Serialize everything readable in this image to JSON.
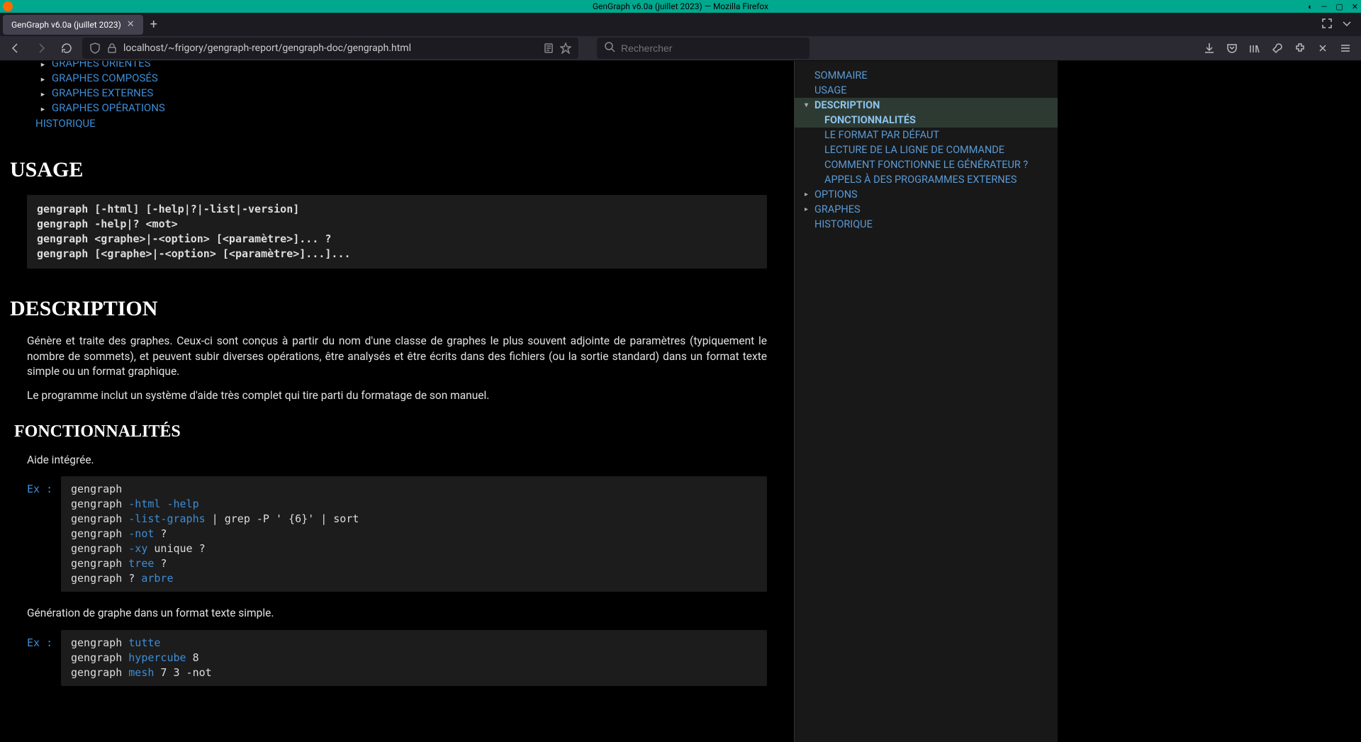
{
  "window": {
    "title": "GenGraph v6.0a (juillet 2023) — Mozilla Firefox"
  },
  "tab": {
    "title": "GenGraph v6.0a (juillet 2023)"
  },
  "urlbar": {
    "url": "localhost/~frigory/gengraph-report/gengraph-doc/gengraph.html"
  },
  "searchbar": {
    "placeholder": "Rechercher"
  },
  "toc_bullets": [
    "GRAPHES ORIENTÉS",
    "GRAPHES COMPOSÉS",
    "GRAPHES EXTERNES",
    "GRAPHES OPÉRATIONS"
  ],
  "toc_historique": "HISTORIQUE",
  "sections": {
    "usage_title": "USAGE",
    "usage_code": "gengraph [-html] [-help|?|-list|-version]\ngengraph -help|? <mot>\ngengraph <graphe>|-<option> [<paramètre>]... ?\ngengraph [<graphe>|-<option> [<paramètre>]...]...",
    "desc_title": "DESCRIPTION",
    "desc_p1": "Génère et traite des graphes. Ceux-ci sont conçus à partir du nom d'une classe de graphes le plus souvent adjointe de paramètres (typiquement le nombre de sommets), et peuvent su­bir diverses opérations, être analysés et être écrits dans des fichiers (ou la sortie standard) dans un format texte simple ou un format graphique.",
    "desc_p2": "Le programme inclut un système d'aide très complet qui tire parti du formatage de son manuel.",
    "func_title": "FONCTIONNALITÉS",
    "func_p1": "Aide intégrée.",
    "ex_label": "Ex :",
    "func_p2": "Génération de graphe dans un format texte simple."
  },
  "ex1_lines": [
    {
      "pre": "gengraph",
      "kw": "",
      "post": ""
    },
    {
      "pre": "gengraph ",
      "kw": "-html -help",
      "post": ""
    },
    {
      "pre": "gengraph ",
      "kw": "-list-graphs",
      "post": " | grep -P ' {6}' | sort"
    },
    {
      "pre": "gengraph ",
      "kw": "-not",
      "post": " ?"
    },
    {
      "pre": "gengraph ",
      "kw": "-xy",
      "post": " unique ?"
    },
    {
      "pre": "gengraph ",
      "kw": "tree",
      "post": " ?"
    },
    {
      "pre": "gengraph ? ",
      "kw": "arbre",
      "post": ""
    }
  ],
  "ex2_lines": [
    {
      "pre": "gengraph ",
      "kw": "tutte",
      "post": ""
    },
    {
      "pre": "gengraph ",
      "kw": "hypercube",
      "post": " 8"
    },
    {
      "pre": "gengraph ",
      "kw": "mesh",
      "post": " 7 3 -not"
    }
  ],
  "sidenav": [
    {
      "label": "SOMMAIRE",
      "indent": 1,
      "arrow": "",
      "active": false
    },
    {
      "label": "USAGE",
      "indent": 1,
      "arrow": "",
      "active": false
    },
    {
      "label": "DESCRIPTION",
      "indent": 1,
      "arrow": "▾",
      "active": true
    },
    {
      "label": "FONCTIONNALITÉS",
      "indent": 2,
      "arrow": "",
      "active": true
    },
    {
      "label": "LE FORMAT PAR DÉFAUT",
      "indent": 2,
      "arrow": "",
      "active": false
    },
    {
      "label": "LECTURE DE LA LIGNE DE COMMANDE",
      "indent": 2,
      "arrow": "",
      "active": false
    },
    {
      "label": "COMMENT FONCTIONNE LE GÉNÉRATEUR ?",
      "indent": 2,
      "arrow": "",
      "active": false
    },
    {
      "label": "APPELS À DES PROGRAMMES EXTERNES",
      "indent": 2,
      "arrow": "",
      "active": false
    },
    {
      "label": "OPTIONS",
      "indent": 1,
      "arrow": "▸",
      "active": false
    },
    {
      "label": "GRAPHES",
      "indent": 1,
      "arrow": "▸",
      "active": false
    },
    {
      "label": "HISTORIQUE",
      "indent": 1,
      "arrow": "",
      "active": false
    }
  ]
}
